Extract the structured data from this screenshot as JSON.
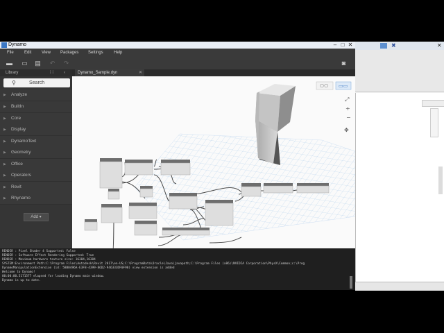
{
  "window": {
    "title": "Dynamo"
  },
  "menu": [
    "File",
    "Edit",
    "View",
    "Packages",
    "Settings",
    "Help"
  ],
  "library": {
    "header": "Library",
    "search_placeholder": "Search",
    "items": [
      "Analyze",
      "BuiltIn",
      "Core",
      "Display",
      "DynamoText",
      "Geometry",
      "Office",
      "Operators",
      "Revit",
      "Rhynamo"
    ],
    "add_label": "Add"
  },
  "tab": {
    "name": "Dynamo_Sample.dyn",
    "close": "✕"
  },
  "console": {
    "lines": [
      "RENDER : Pixel Shader 4 Supported: False",
      "RENDER : Software Effect Rendering Supported: True",
      "RENDER : Maximum hardware texture size: 16384,16384",
      "SYSTEM:Environment Path:C:\\Program Files\\Autodesk\\Revit 2017\\en-US;C:\\ProgramData\\Oracle\\Java\\javapath;C:\\Program Files (x86)\\NVIDIA Corporation\\PhysX\\Common;c:\\Prog",
      "DynamoManipulationExtension (id: 58B0496A-E3F8-4399-86D2-946333DF0F98) view extension is added",
      "Welcome to Dynamo!",
      "00:00:00.5171577 elapsed for loading Dynamo main window.",
      "Dynamo is up to date."
    ]
  },
  "colors": {
    "accent": "#3a77c4",
    "canvas": "#fafafa",
    "node_header": "#6e6e6e",
    "node_body": "#dedede"
  }
}
